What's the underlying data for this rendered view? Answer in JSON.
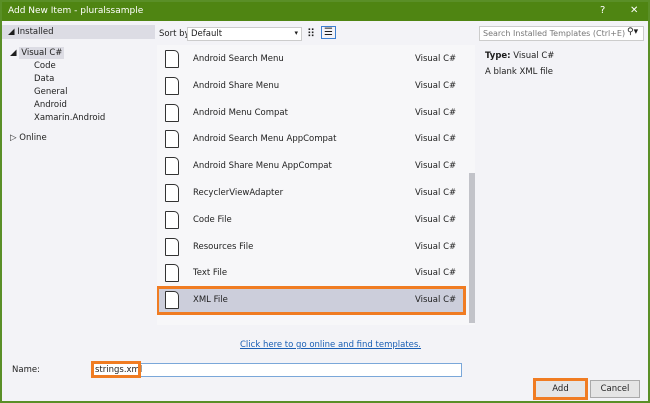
{
  "window": {
    "title": "Add New Item - pluralssample",
    "help": "?",
    "close": "✕"
  },
  "tree": {
    "installed": "Installed",
    "visual_cs": "Visual C#",
    "children": [
      "Code",
      "Data",
      "General",
      "Android",
      "Xamarin.Android"
    ],
    "online": "Online"
  },
  "sort": {
    "label": "Sort by:",
    "value": "Default"
  },
  "items": [
    {
      "name": "Android Search Menu",
      "lang": "Visual C#"
    },
    {
      "name": "Android Share Menu",
      "lang": "Visual C#"
    },
    {
      "name": "Android Menu Compat",
      "lang": "Visual C#"
    },
    {
      "name": "Android Search Menu AppCompat",
      "lang": "Visual C#"
    },
    {
      "name": "Android Share Menu AppCompat",
      "lang": "Visual C#"
    },
    {
      "name": "RecyclerViewAdapter",
      "lang": "Visual C#"
    },
    {
      "name": "Code File",
      "lang": "Visual C#"
    },
    {
      "name": "Resources File",
      "lang": "Visual C#"
    },
    {
      "name": "Text File",
      "lang": "Visual C#"
    },
    {
      "name": "XML File",
      "lang": "Visual C#"
    }
  ],
  "search": {
    "placeholder": "Search Installed Templates (Ctrl+E)"
  },
  "details": {
    "type_label": "Type:",
    "type_value": "Visual C#",
    "description": "A blank XML file"
  },
  "online_link": "Click here to go online and find templates.",
  "name": {
    "label": "Name:",
    "value": "strings.xml"
  },
  "buttons": {
    "add": "Add",
    "cancel": "Cancel"
  }
}
